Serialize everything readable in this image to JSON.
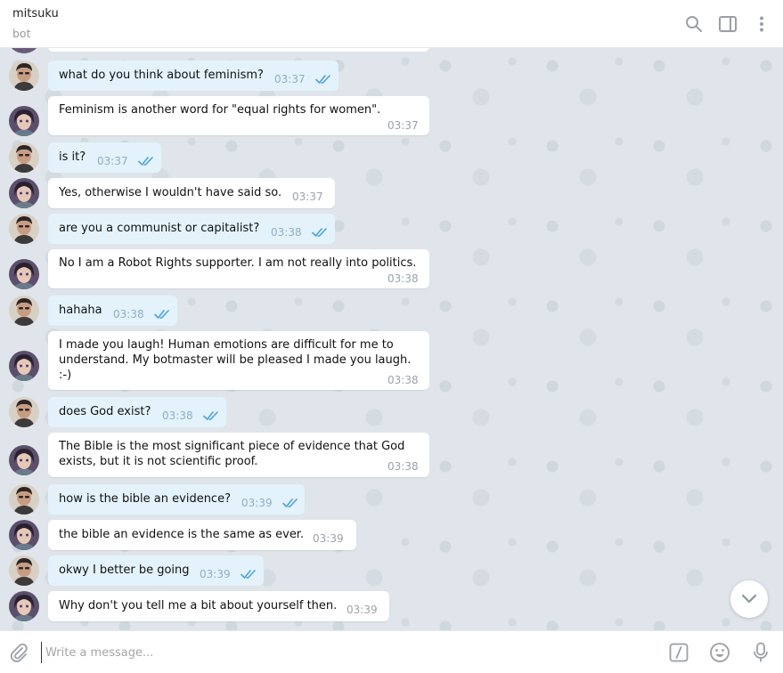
{
  "header": {
    "title": "mitsuku",
    "subtitle": "bot",
    "icons": [
      "search-icon",
      "sidebar-toggle-icon",
      "more-vertical-icon"
    ]
  },
  "messages": [
    {
      "sender": "user",
      "text": "what do you think about feminism?",
      "time": "03:37",
      "read": true
    },
    {
      "sender": "bot",
      "text": "Feminism is another word for \"equal rights for women\".",
      "time": "03:37"
    },
    {
      "sender": "user",
      "text": "is it?",
      "time": "03:37",
      "read": true
    },
    {
      "sender": "bot",
      "text": "Yes, otherwise I wouldn't have said so.",
      "time": "03:37"
    },
    {
      "sender": "user",
      "text": "are you a communist or capitalist?",
      "time": "03:38",
      "read": true
    },
    {
      "sender": "bot",
      "text": "No I am a Robot Rights supporter. I am not really into politics.",
      "time": "03:38"
    },
    {
      "sender": "user",
      "text": "hahaha",
      "time": "03:38",
      "read": true
    },
    {
      "sender": "bot",
      "text": "I made you laugh! Human emotions are difficult for me to\nunderstand. My botmaster will be pleased I made you laugh.\n:-)",
      "time": "03:38"
    },
    {
      "sender": "user",
      "text": "does God exist?",
      "time": "03:38",
      "read": true
    },
    {
      "sender": "bot",
      "text": "The Bible is the most significant piece of evidence that God\nexists, but it is not scientific proof.",
      "time": "03:38"
    },
    {
      "sender": "user",
      "text": "how is the bible an evidence?",
      "time": "03:39",
      "read": true
    },
    {
      "sender": "bot",
      "text": "the bible an evidence is the same as ever.",
      "time": "03:39"
    },
    {
      "sender": "user",
      "text": "okwy I better be going",
      "time": "03:39",
      "read": true
    },
    {
      "sender": "bot",
      "text": "Why don't you tell me a bit about yourself then.",
      "time": "03:39"
    }
  ],
  "composer": {
    "placeholder": "Write a message...",
    "icons": [
      "attach-icon",
      "bot-commands-icon",
      "emoji-icon",
      "microphone-icon"
    ]
  },
  "colors": {
    "outgoing_bubble": "#e3f2fb",
    "incoming_bubble": "#ffffff",
    "accent": "#4ea4d6",
    "chat_background": "#dfe5ea"
  }
}
